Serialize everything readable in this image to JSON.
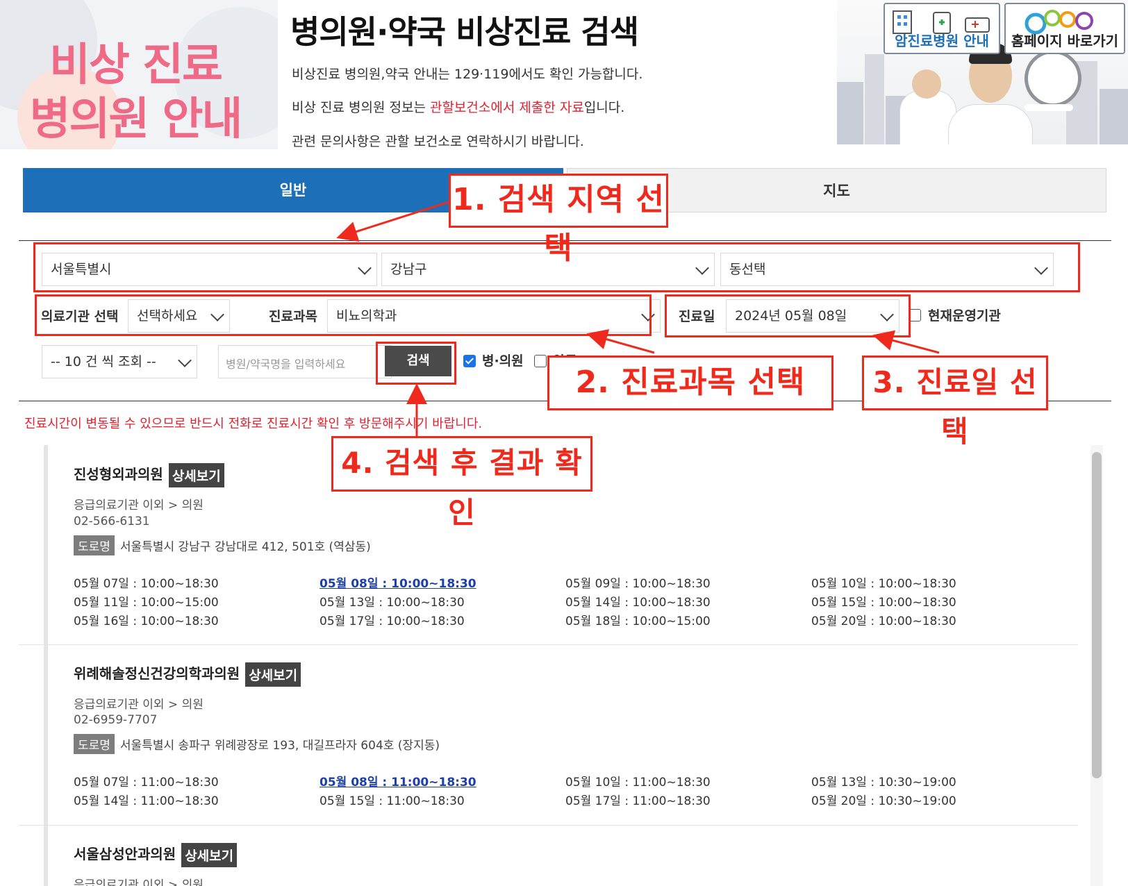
{
  "header": {
    "logo_line1": "비상 진료",
    "logo_line2": "병의원 안내",
    "title": "병의원·약국 비상진료 검색",
    "notice1": "비상진료 병의원,약국 안내는 129·119에서도 확인 가능합니다.",
    "notice2_prefix": "비상 진료 병의원 정보는 ",
    "notice2_highlight": "관할보건소에서 제출한 자료",
    "notice2_suffix": "입니다.",
    "notice3": "관련 문의사항은 관할 보건소로 연락하시기 바랍니다.",
    "quick_links": [
      "암진료병원 안내",
      "홈페이지 바로가기"
    ]
  },
  "tabs": {
    "general": "일반",
    "map": "지도"
  },
  "search": {
    "region1": "서울특별시",
    "region2": "강남구",
    "region3": "동선택",
    "inst_label": "의료기관 선택",
    "inst_value": "선택하세요",
    "dept_label": "진료과목",
    "dept_value": "비뇨의학과",
    "date_label": "진료일",
    "date_value": "2024년 05월 08일",
    "open_now_label": "현재운영기관",
    "page_size": "-- 10 건 씩 조회 --",
    "name_placeholder": "병원/약국명을 입력하세요",
    "search_button": "검색",
    "type_hospital": "병·의원",
    "type_pharmacy": "약국"
  },
  "warning": "진료시간이 변동될 수 있으므로 반드시 전화로 진료시간 확인 후 방문해주시기 바랍니다.",
  "detail_label": "상세보기",
  "road_label": "도로명",
  "results": [
    {
      "name": "진성형외과의원",
      "category": "응급의료기관 이외 > 의원",
      "tel": "02-566-6131",
      "address": "서울특별시 강남구 강남대로 412, 501호 (역삼동)",
      "schedule": [
        "05월 07일 : 10:00~18:30",
        "05월 08일 : 10:00~18:30",
        "05월 09일 : 10:00~18:30",
        "05월 10일 : 10:00~18:30",
        "05월 11일 : 10:00~15:00",
        "05월 13일 : 10:00~18:30",
        "05월 14일 : 10:00~18:30",
        "05월 15일 : 10:00~18:30",
        "05월 16일 : 10:00~18:30",
        "05월 17일 : 10:00~18:30",
        "05월 18일 : 10:00~15:00",
        "05월 20일 : 10:00~18:30"
      ]
    },
    {
      "name": "위례해솔정신건강의학과의원",
      "category": "응급의료기관 이외 > 의원",
      "tel": "02-6959-7707",
      "address": "서울특별시 송파구 위례광장로 193, 대길프라자 604호 (장지동)",
      "schedule": [
        "05월 07일 : 11:00~18:30",
        "05월 08일 : 11:00~18:30",
        "05월 10일 : 11:00~18:30",
        "05월 13일 : 10:30~19:00",
        "05월 14일 : 11:00~18:30",
        "05월 15일 : 11:00~18:30",
        "05월 17일 : 11:00~18:30",
        "05월 20일 : 10:30~19:00"
      ]
    },
    {
      "name": "서울삼성안과의원",
      "category": "응급의료기관 이외 > 의원"
    }
  ],
  "annotations": {
    "step1": "1. 검색 지역 선택",
    "step2": "2. 진료과목 선택",
    "step3": "3. 진료일 선택",
    "step4": "4. 검색 후 결과 확인",
    "color": "#ef2a1c"
  },
  "colors": {
    "tab_active": "#1d70b8",
    "logo_pink": "#ee6a86",
    "warning_red": "#e5202e"
  }
}
